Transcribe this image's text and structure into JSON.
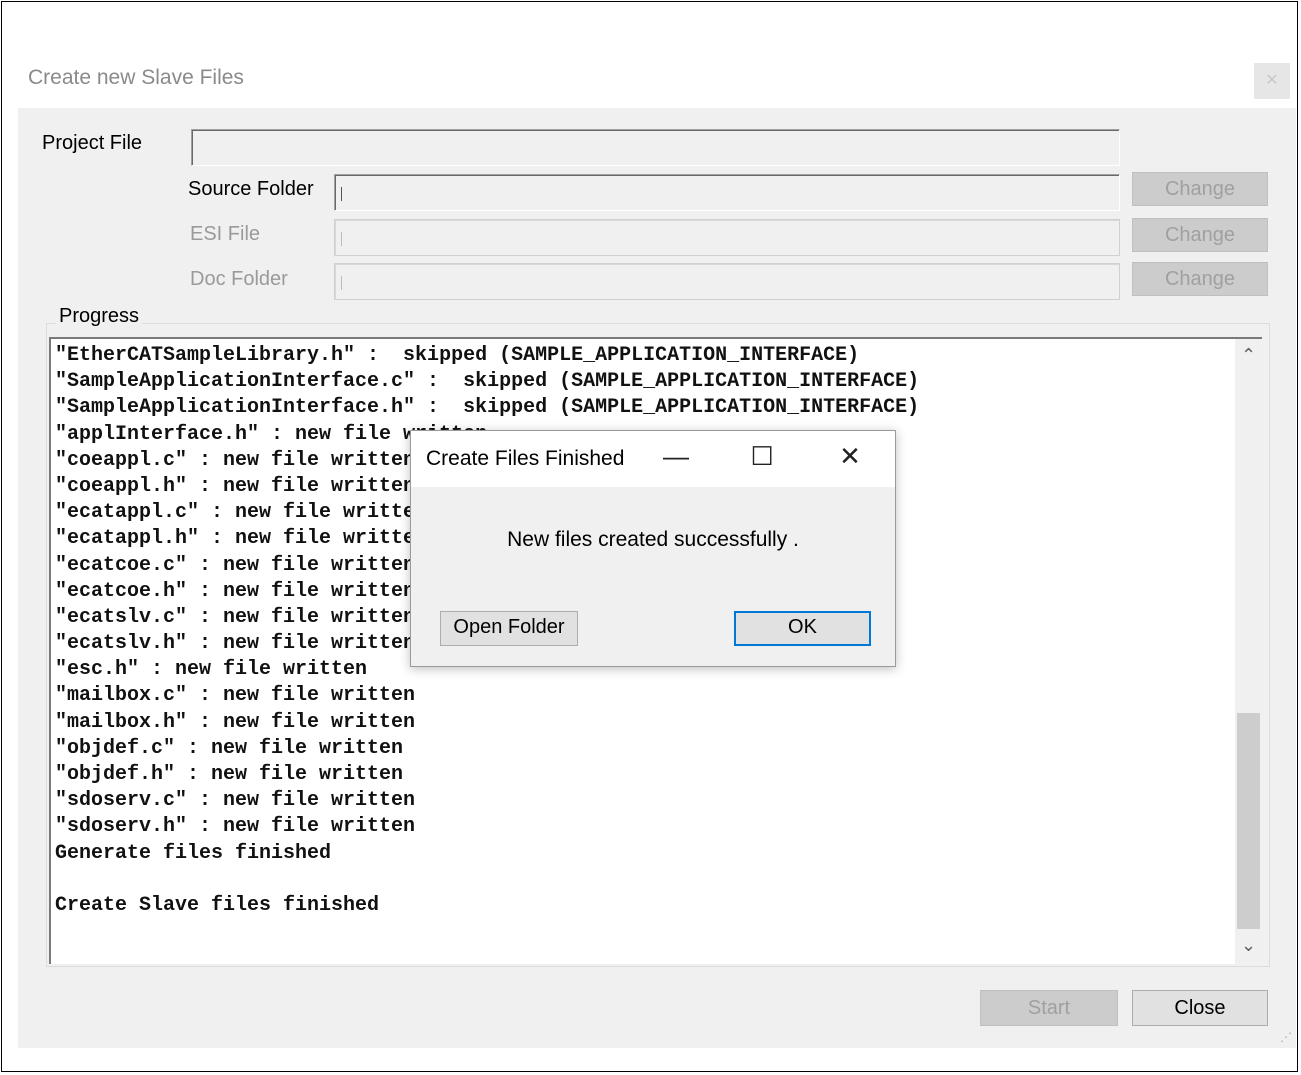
{
  "window": {
    "title": "Create new Slave Files",
    "close_glyph": "✕"
  },
  "form": {
    "project_file_label": "Project File",
    "project_file_value": "",
    "source_folder_label": "Source Folder",
    "esi_file_label": "ESI File",
    "doc_folder_label": "Doc Folder",
    "change_label": "Change"
  },
  "progress": {
    "label": "Progress",
    "lines": [
      "\"EtherCATSampleLibrary.h\" :  skipped (SAMPLE_APPLICATION_INTERFACE)",
      "\"SampleApplicationInterface.c\" :  skipped (SAMPLE_APPLICATION_INTERFACE)",
      "\"SampleApplicationInterface.h\" :  skipped (SAMPLE_APPLICATION_INTERFACE)",
      "\"applInterface.h\" : new file written",
      "\"coeappl.c\" : new file written",
      "\"coeappl.h\" : new file written",
      "\"ecatappl.c\" : new file written",
      "\"ecatappl.h\" : new file written",
      "\"ecatcoe.c\" : new file written",
      "\"ecatcoe.h\" : new file written",
      "\"ecatslv.c\" : new file written",
      "\"ecatslv.h\" : new file written",
      "\"esc.h\" : new file written",
      "\"mailbox.c\" : new file written",
      "\"mailbox.h\" : new file written",
      "\"objdef.c\" : new file written",
      "\"objdef.h\" : new file written",
      "\"sdoserv.c\" : new file written",
      "\"sdoserv.h\" : new file written",
      "Generate files finished",
      "",
      "Create Slave files finished"
    ],
    "scroll_up_icon": "chevron-up-icon",
    "scroll_down_icon": "chevron-down-icon"
  },
  "footer": {
    "start_label": "Start",
    "close_label": "Close"
  },
  "dialog": {
    "title": "Create Files Finished",
    "minimize_glyph": "—",
    "maximize_glyph": "☐",
    "close_glyph": "✕",
    "message": "New files created successfully .",
    "open_folder_label": "Open Folder",
    "ok_label": "OK"
  }
}
